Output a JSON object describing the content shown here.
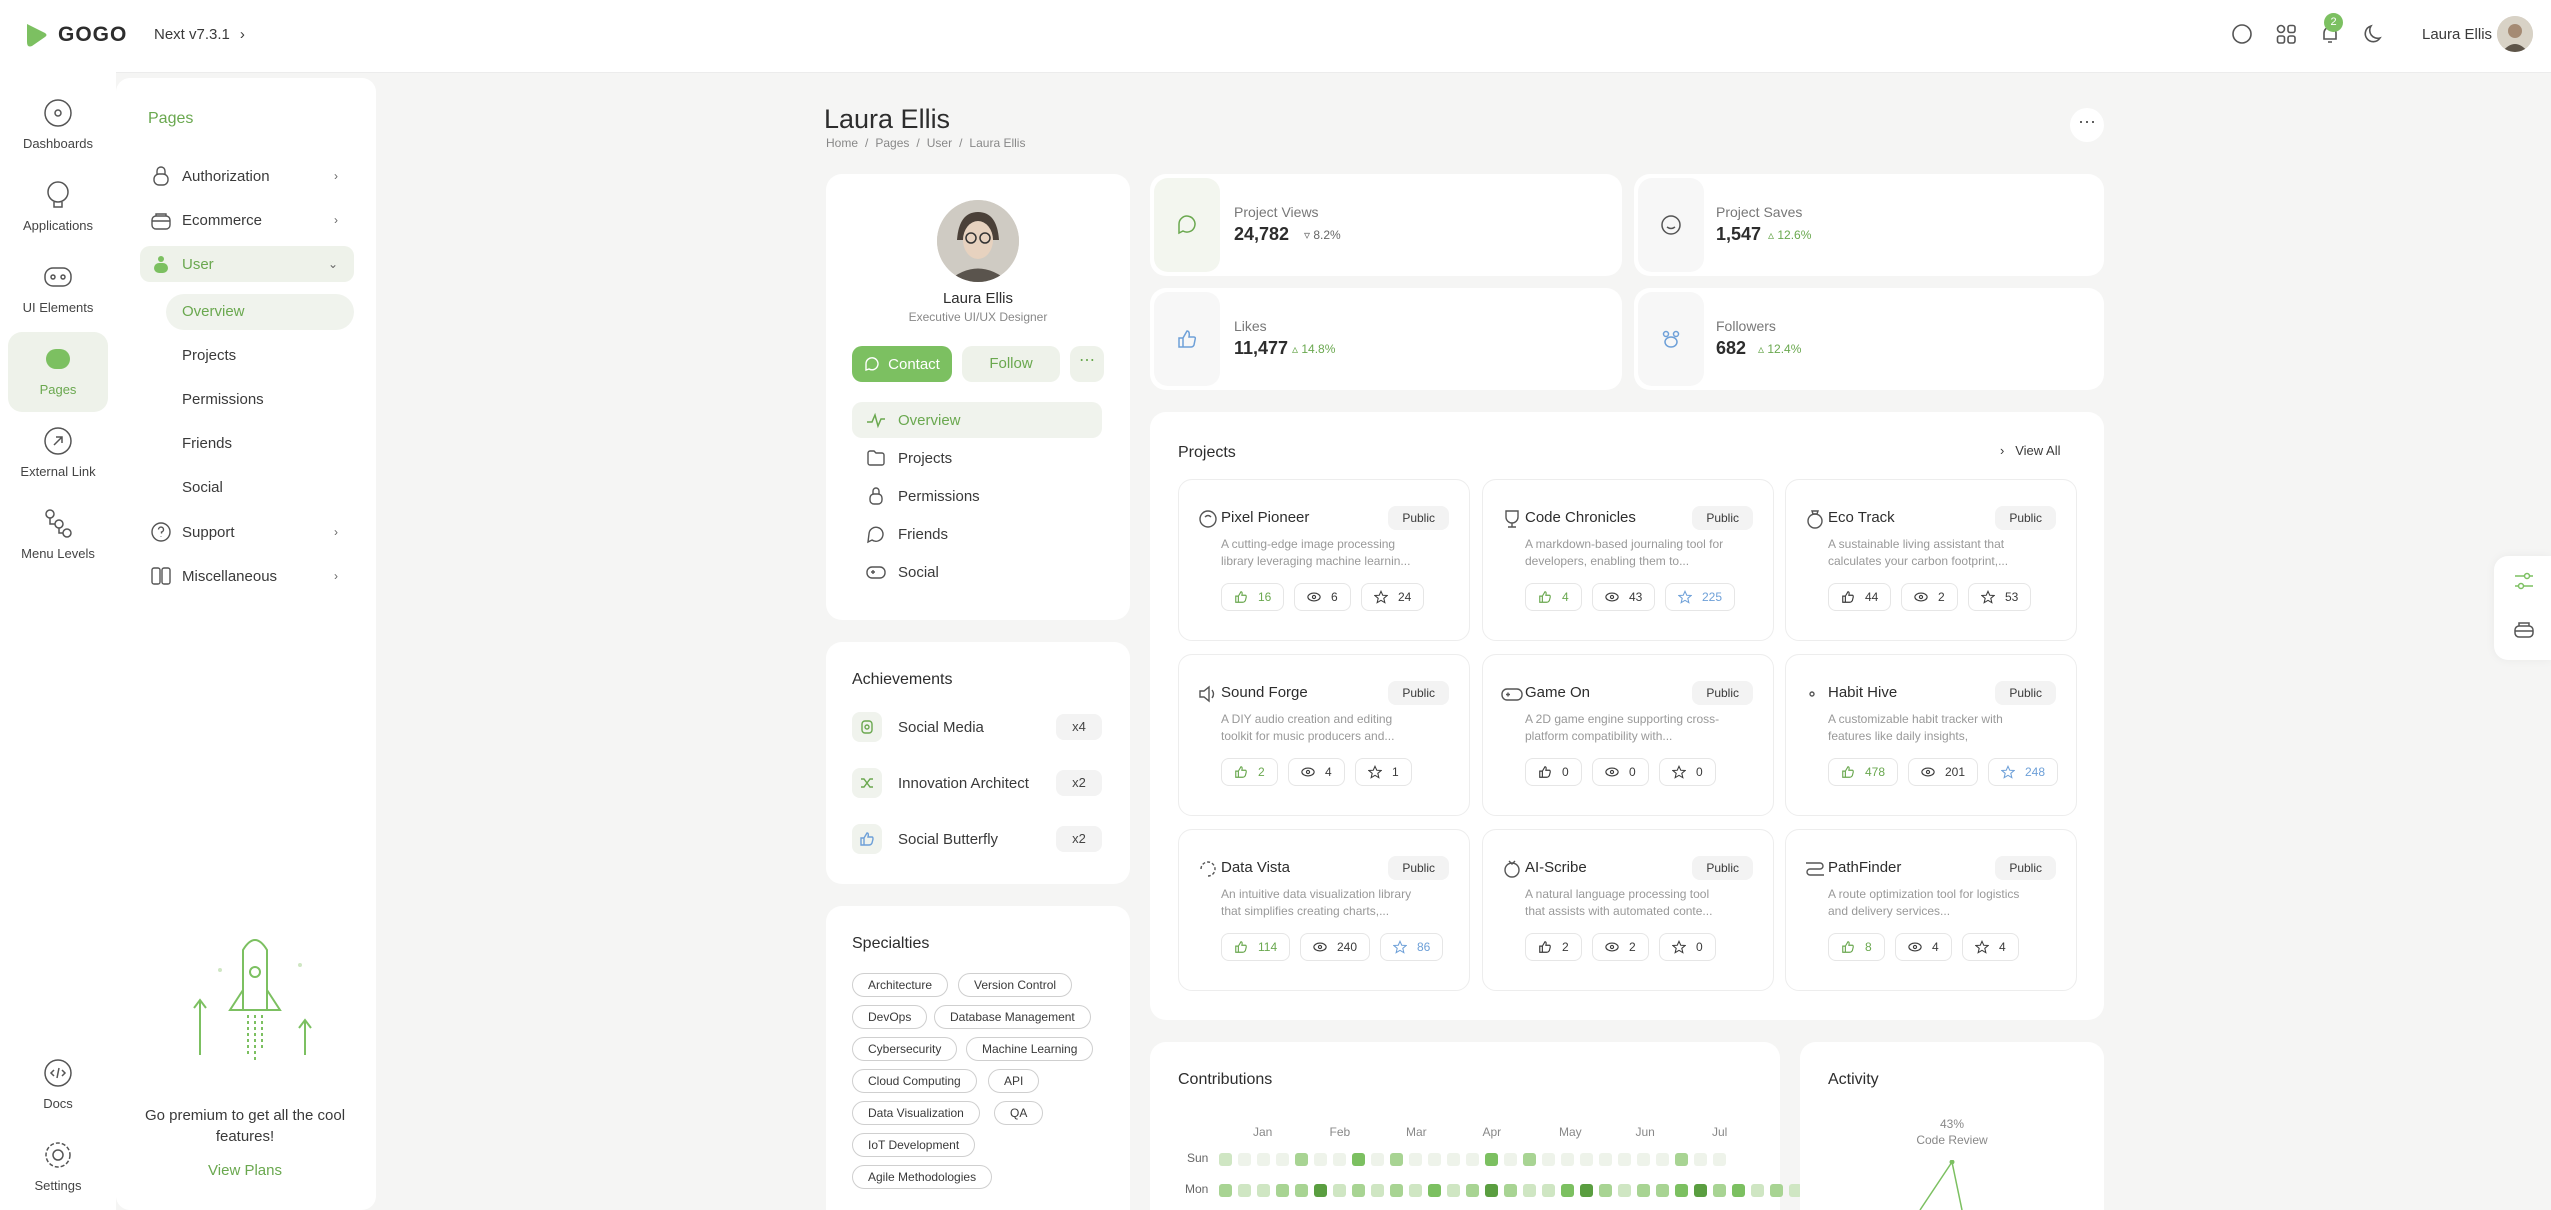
{
  "header": {
    "brand": "GOGO",
    "version": "Next v7.3.1",
    "notification_count": "2",
    "user_name": "Laura Ellis"
  },
  "rail": [
    {
      "label": "Dashboards",
      "icon": "dashboard-icon"
    },
    {
      "label": "Applications",
      "icon": "applications-icon"
    },
    {
      "label": "UI Elements",
      "icon": "ui-elements-icon"
    },
    {
      "label": "Pages",
      "icon": "pages-icon"
    },
    {
      "label": "External Link",
      "icon": "external-link-icon"
    },
    {
      "label": "Menu Levels",
      "icon": "menu-levels-icon"
    }
  ],
  "rail_bottom": [
    {
      "label": "Docs"
    },
    {
      "label": "Settings"
    }
  ],
  "sidebar": {
    "title": "Pages",
    "items": [
      {
        "label": "Authorization"
      },
      {
        "label": "Ecommerce"
      },
      {
        "label": "User"
      }
    ],
    "user_sub": [
      "Overview",
      "Projects",
      "Permissions",
      "Friends",
      "Social"
    ],
    "items_after": [
      {
        "label": "Support"
      },
      {
        "label": "Miscellaneous"
      }
    ],
    "promo_text": "Go premium to get all the cool features!",
    "promo_link": "View Plans"
  },
  "page": {
    "title": "Laura Ellis",
    "breadcrumb": [
      "Home",
      "/",
      "Pages",
      "/",
      "User",
      "/",
      "Laura Ellis"
    ]
  },
  "profile": {
    "name": "Laura Ellis",
    "role": "Executive UI/UX Designer",
    "contact": "Contact",
    "follow": "Follow",
    "nav": [
      "Overview",
      "Projects",
      "Permissions",
      "Friends",
      "Social"
    ]
  },
  "achievements": {
    "title": "Achievements",
    "items": [
      {
        "label": "Social Media",
        "count": "x4"
      },
      {
        "label": "Innovation Architect",
        "count": "x2"
      },
      {
        "label": "Social Butterfly",
        "count": "x2"
      }
    ]
  },
  "specialties": {
    "title": "Specialties",
    "tags": [
      "Architecture",
      "Version Control",
      "DevOps",
      "Database Management",
      "Cybersecurity",
      "Machine Learning",
      "Cloud Computing",
      "API",
      "Data Visualization",
      "QA",
      "IoT Development",
      "Agile Methodologies"
    ]
  },
  "stats": [
    {
      "label": "Project Views",
      "value": "24,782",
      "change": "8.2%",
      "trend": "down"
    },
    {
      "label": "Project Saves",
      "value": "1,547",
      "change": "12.6%",
      "trend": "up"
    },
    {
      "label": "Likes",
      "value": "11,477",
      "change": "14.8%",
      "trend": "up"
    },
    {
      "label": "Followers",
      "value": "682",
      "change": "12.4%",
      "trend": "up"
    }
  ],
  "projects": {
    "title": "Projects",
    "view_all": "View All",
    "public_label": "Public",
    "items": [
      {
        "name": "Pixel Pioneer",
        "desc": "A cutting-edge image processing library leveraging machine learnin...",
        "likes": "16",
        "views": "6",
        "stars": "24",
        "liked": true,
        "starred": false
      },
      {
        "name": "Code Chronicles",
        "desc": "A markdown-based journaling tool for developers, enabling them to...",
        "likes": "4",
        "views": "43",
        "stars": "225",
        "liked": true,
        "starred": true
      },
      {
        "name": "Eco Track",
        "desc": "A sustainable living assistant that calculates your carbon footprint,...",
        "likes": "44",
        "views": "2",
        "stars": "53",
        "liked": false,
        "starred": false
      },
      {
        "name": "Sound Forge",
        "desc": "A DIY audio creation and editing toolkit for music producers and...",
        "likes": "2",
        "views": "4",
        "stars": "1",
        "liked": true,
        "starred": false
      },
      {
        "name": "Game On",
        "desc": "A 2D game engine supporting cross-platform compatibility with...",
        "likes": "0",
        "views": "0",
        "stars": "0",
        "liked": false,
        "starred": false
      },
      {
        "name": "Habit Hive",
        "desc": "A customizable habit tracker with features like daily insights, reminders,...",
        "likes": "478",
        "views": "201",
        "stars": "248",
        "liked": true,
        "starred": true
      },
      {
        "name": "Data Vista",
        "desc": "An intuitive data visualization library that simplifies creating charts,...",
        "likes": "114",
        "views": "240",
        "stars": "86",
        "liked": true,
        "starred": true
      },
      {
        "name": "AI-Scribe",
        "desc": "A natural language processing tool that assists with automated conte...",
        "likes": "2",
        "views": "2",
        "stars": "0",
        "liked": false,
        "starred": false
      },
      {
        "name": "PathFinder",
        "desc": "A route optimization tool for logistics and delivery services...",
        "likes": "8",
        "views": "4",
        "stars": "4",
        "liked": true,
        "starred": false
      }
    ]
  },
  "contributions": {
    "title": "Contributions",
    "months": [
      "Jan",
      "Feb",
      "Mar",
      "Apr",
      "May",
      "Jun",
      "Jul"
    ],
    "days": [
      "Sun",
      "Mon"
    ],
    "sun": [
      1,
      0,
      0,
      0,
      2,
      0,
      0,
      3,
      0,
      2,
      0,
      0,
      0,
      0,
      3,
      0,
      2,
      0,
      0,
      0,
      0,
      0,
      0,
      0,
      2,
      0,
      0
    ],
    "mon": [
      2,
      1,
      1,
      2,
      2,
      4,
      1,
      2,
      1,
      2,
      1,
      3,
      1,
      2,
      4,
      2,
      1,
      1,
      3,
      4,
      2,
      1,
      2,
      2,
      3,
      4,
      2,
      3,
      1,
      2,
      1,
      4
    ]
  },
  "activity": {
    "title": "Activity",
    "label_pct": "43%",
    "label_name": "Code Review"
  },
  "colors": {
    "accent": "#7cc061",
    "accent_dark": "#6aa84f",
    "accent_bg": "#eef2ea",
    "blue": "#6ea0d8"
  }
}
